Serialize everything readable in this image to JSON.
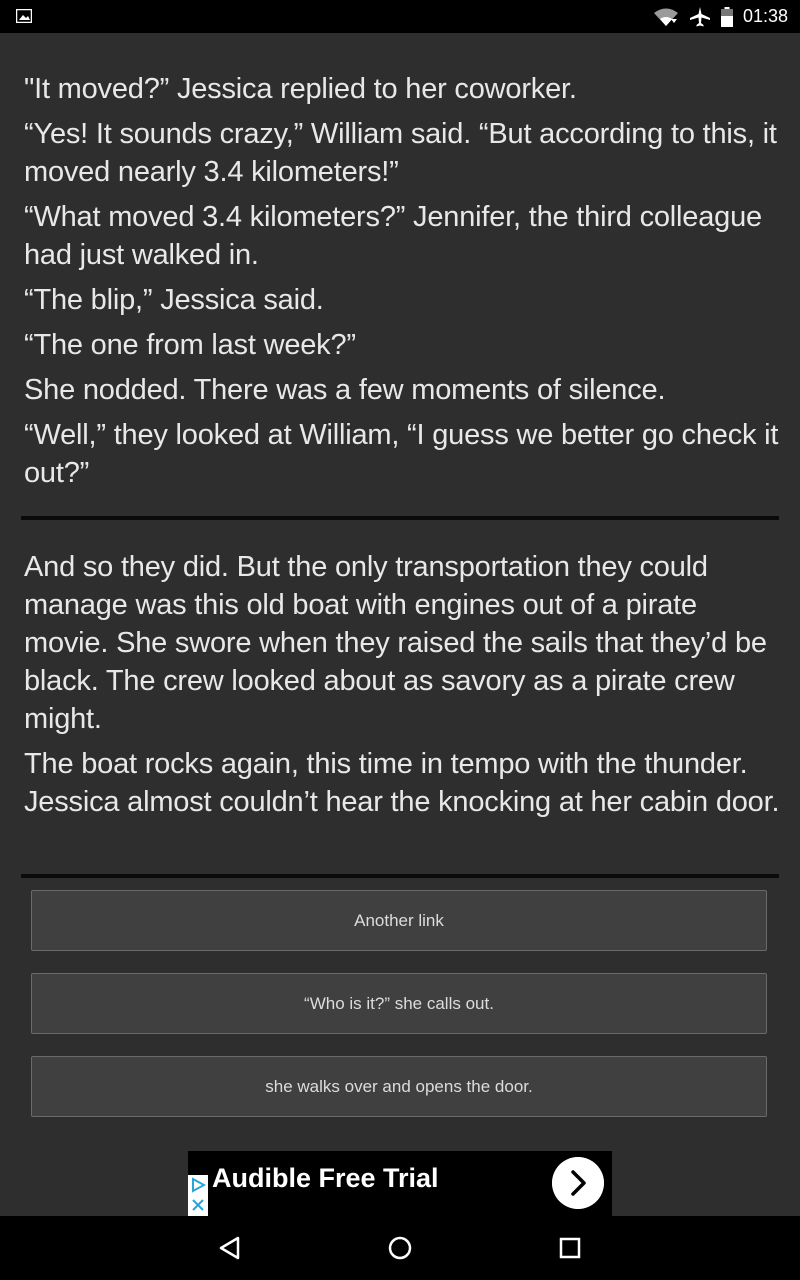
{
  "status_bar": {
    "time": "01:38",
    "icons": [
      "image-icon",
      "wifi-icon",
      "airplane-icon",
      "battery-icon"
    ]
  },
  "story": {
    "section1": [
      "\"It moved?” Jessica replied to her coworker.",
      "“Yes! It sounds crazy,” William said. “But according to this, it moved nearly 3.4 kilometers!”",
      "“What moved 3.4 kilometers?” Jennifer, the third colleague had just walked in.",
      "“The blip,” Jessica said.",
      "“The one from last week?”",
      "She nodded. There was a few moments of silence.",
      "“Well,” they looked at William, “I guess we better go check it out?”"
    ],
    "section2": [
      "And so they did. But the only transportation they could manage was this old boat with engines out of a pirate movie. She swore when they raised the sails that they’d be black. The crew looked about as savory as a pirate crew might.",
      "The boat rocks again, this time in tempo with the thunder. Jessica almost couldn’t hear the knocking at her cabin door."
    ]
  },
  "choices": [
    "Another link",
    "“Who is it?” she calls out.",
    "she walks over and opens the door."
  ],
  "ad": {
    "text": "Audible Free Trial"
  },
  "colors": {
    "background": "#2e2e2e",
    "button_bg": "#404040",
    "text": "#e6e6e6"
  }
}
